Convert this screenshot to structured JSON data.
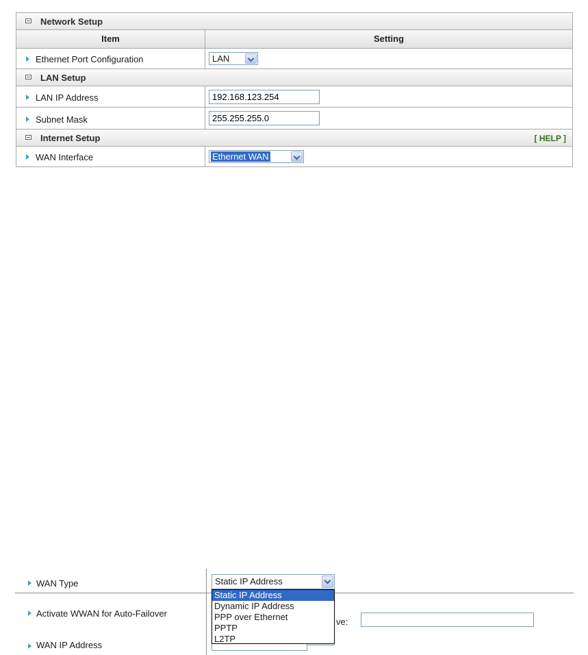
{
  "network_setup": {
    "title": "Network Setup",
    "header": {
      "item": "Item",
      "setting": "Setting"
    },
    "ethernet_port": {
      "label": "Ethernet Port Configuration",
      "value": "LAN"
    }
  },
  "lan_setup": {
    "title": "LAN Setup",
    "lan_ip": {
      "label": "LAN IP Address",
      "value": "192.168.123.254"
    },
    "subnet": {
      "label": "Subnet Mask",
      "value": "255.255.255.0"
    }
  },
  "internet_setup": {
    "title": "Internet Setup",
    "help": "[ HELP ]",
    "wan_interface": {
      "label": "WAN Interface",
      "value": "Ethernet WAN"
    }
  },
  "wan_fragment": {
    "wan_type": {
      "label": "WAN Type",
      "value": "Static IP Address"
    },
    "options": [
      "Static IP Address",
      "Dynamic IP Address",
      "PPP over Ethernet",
      "PPTP",
      "L2TP"
    ],
    "activate_wwan": {
      "label": "Activate WWAN for Auto-Failover",
      "partial_text": "ve:"
    },
    "wan_ip": {
      "label": "WAN IP Address"
    }
  },
  "colors": {
    "accent": "#316ac5",
    "help_link": "#3a6e1a",
    "bullet": "#4a9bd0"
  },
  "icons": {
    "section": "collapse-square-icon",
    "bullet": "triangle-right-icon",
    "select": "chevron-down-icon"
  }
}
